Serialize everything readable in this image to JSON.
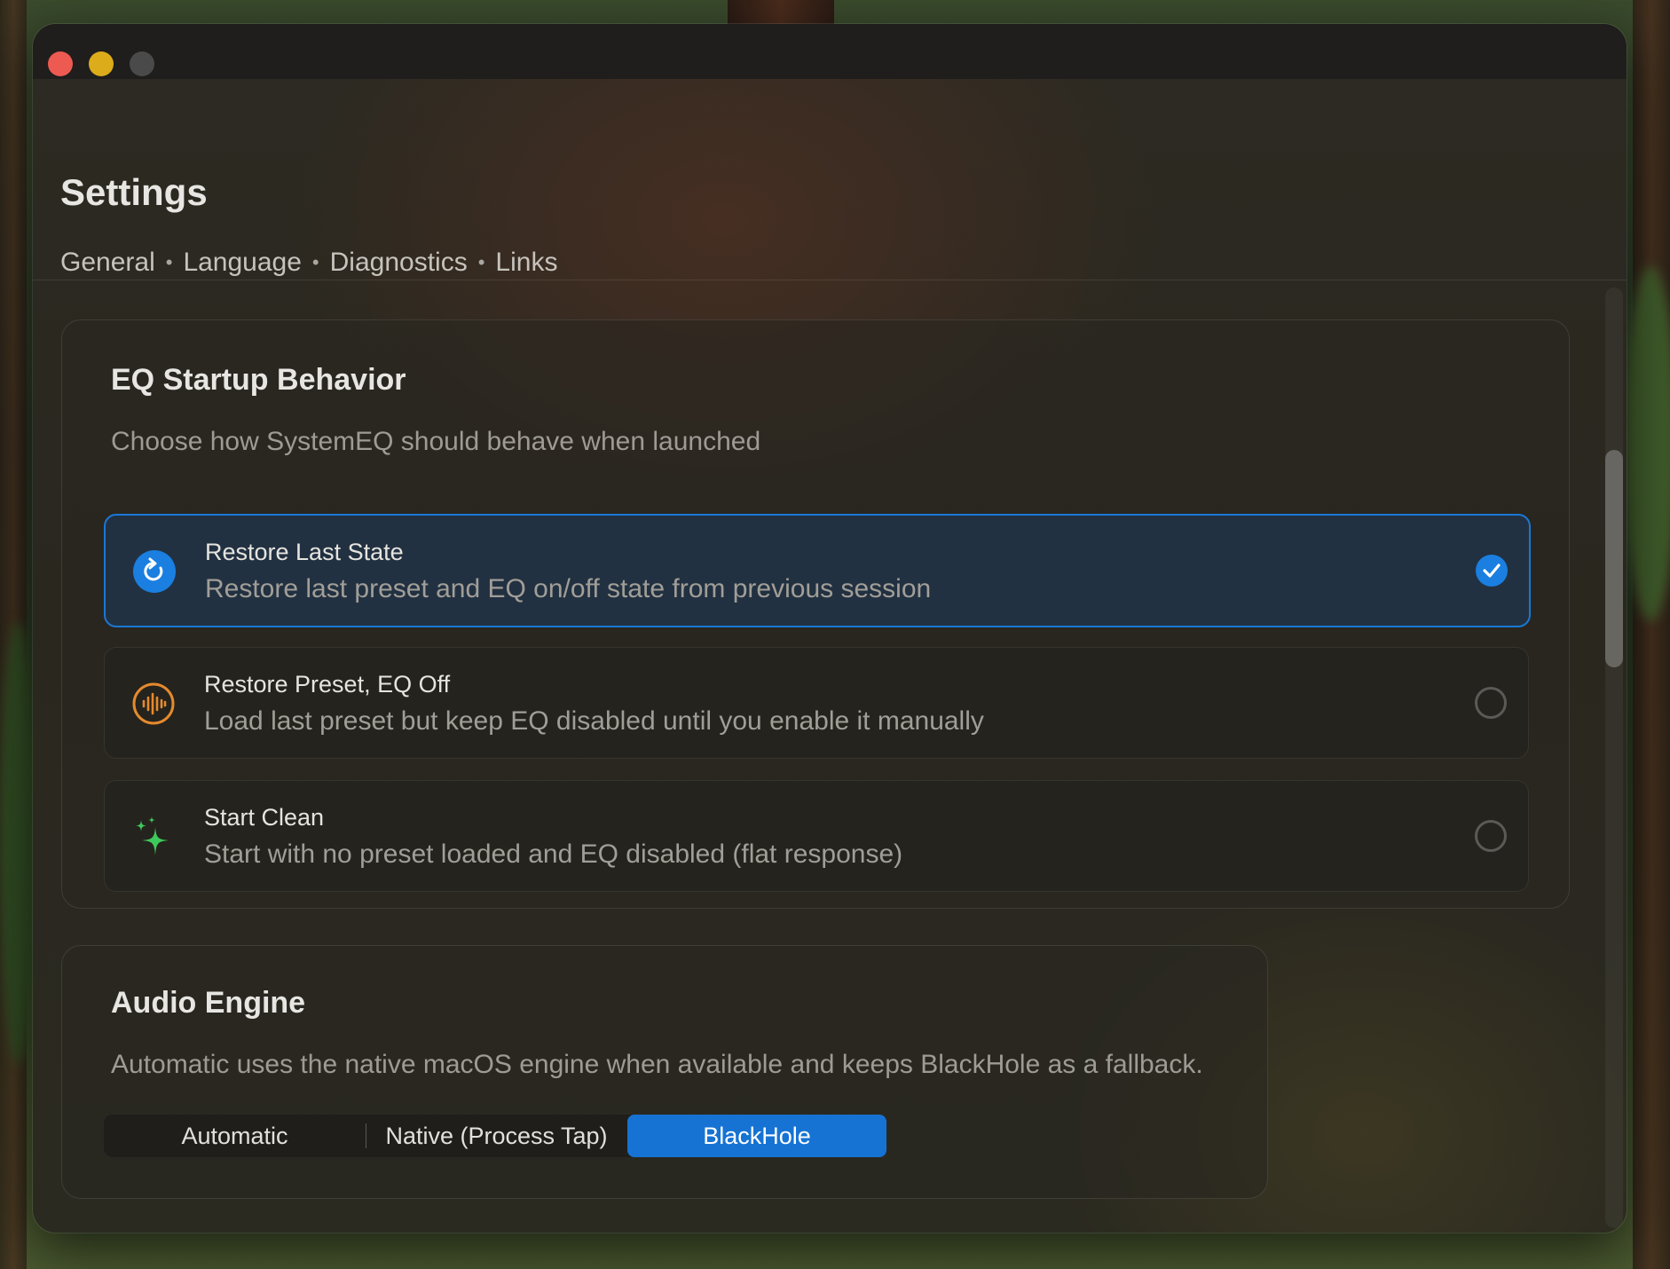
{
  "window": {
    "title": "Settings",
    "tabs": [
      {
        "label": "General"
      },
      {
        "label": "Language"
      },
      {
        "label": "Diagnostics"
      },
      {
        "label": "Links"
      }
    ],
    "tab_separator": "•"
  },
  "startup": {
    "title": "EQ Startup Behavior",
    "description": "Choose how SystemEQ should behave when launched",
    "options": [
      {
        "label": "Restore Last State",
        "description": "Restore last preset and EQ on/off state from previous session",
        "icon": "refresh-icon",
        "selected": true,
        "icon_color": "#1a7fe0"
      },
      {
        "label": "Restore Preset, EQ Off",
        "description": "Load last preset but keep EQ disabled until you enable it manually",
        "icon": "waveform-icon",
        "selected": false,
        "icon_color": "#e58a2e"
      },
      {
        "label": "Start Clean",
        "description": "Start with no preset loaded and EQ disabled (flat response)",
        "icon": "sparkles-icon",
        "selected": false,
        "icon_color": "#3ec95c"
      }
    ]
  },
  "engine": {
    "title": "Audio Engine",
    "description": "Automatic uses the native macOS engine when available and keeps BlackHole as a fallback.",
    "segments": [
      {
        "label": "Automatic",
        "selected": false
      },
      {
        "label": "Native (Process Tap)",
        "selected": false
      },
      {
        "label": "BlackHole",
        "selected": true
      }
    ]
  },
  "colors": {
    "accent": "#1a7fe0",
    "close": "#ed5a52",
    "minimize": "#dcac1b",
    "zoom": "#4a4a4a"
  }
}
